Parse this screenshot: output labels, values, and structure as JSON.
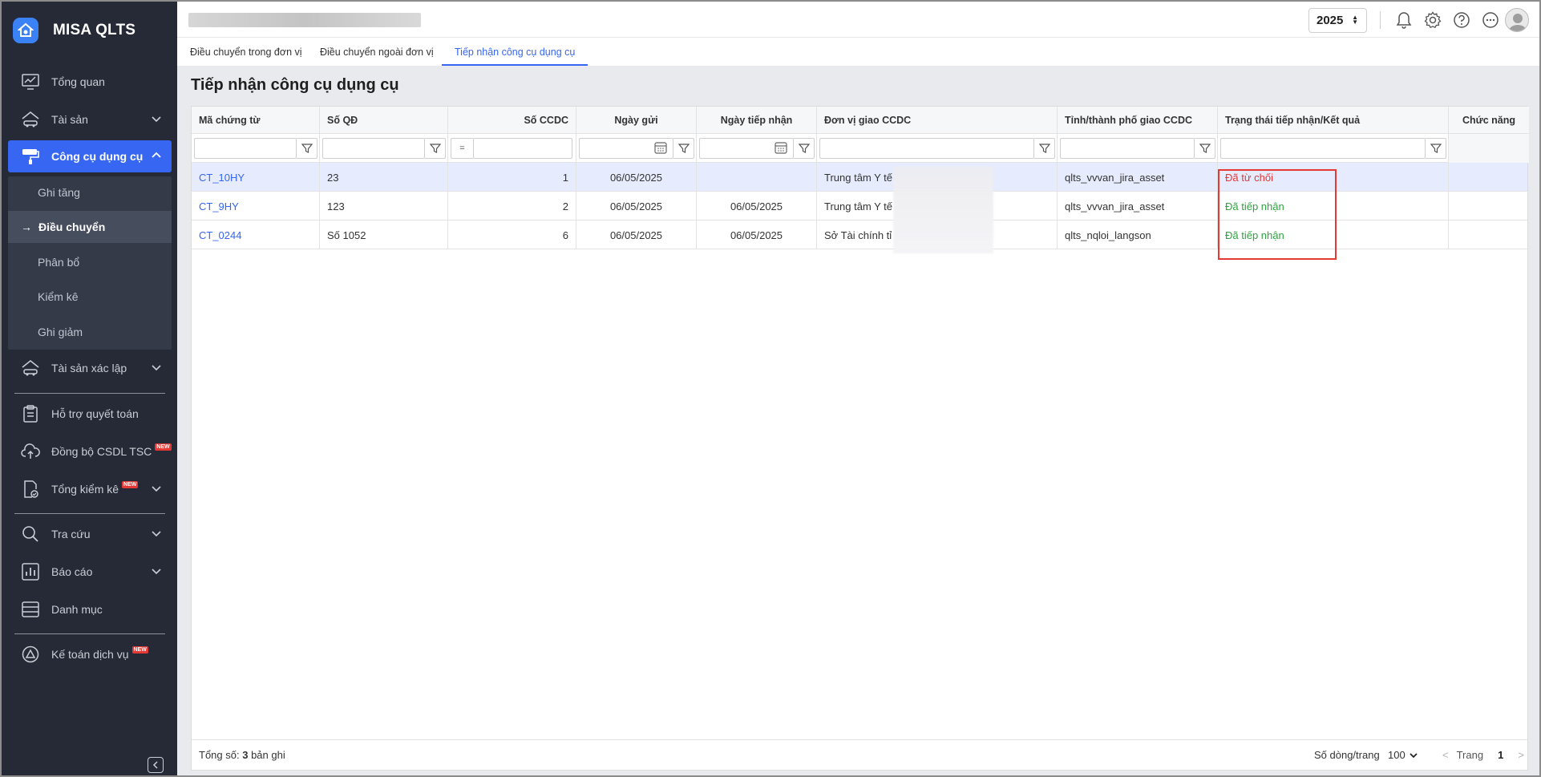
{
  "app": {
    "name": "MISA QLTS"
  },
  "sidebar": {
    "items": [
      {
        "label": "Tổng quan",
        "icon": "chart-monitor-icon"
      },
      {
        "label": "Tài sản",
        "icon": "house-car-icon"
      },
      {
        "label": "Công cụ dụng cụ",
        "icon": "paint-roller-icon"
      },
      {
        "label": "Tài sản xác lập",
        "icon": "house-car-icon"
      },
      {
        "label": "Hỗ trợ quyết toán",
        "icon": "clipboard-icon"
      },
      {
        "label": "Đồng bộ CSDL TSC",
        "icon": "cloud-upload-icon",
        "badge": "NEW"
      },
      {
        "label": "Tổng kiểm kê",
        "icon": "document-check-icon",
        "badge": "NEW"
      },
      {
        "label": "Tra cứu",
        "icon": "search-icon"
      },
      {
        "label": "Báo cáo",
        "icon": "bar-chart-icon"
      },
      {
        "label": "Danh mục",
        "icon": "list-icon"
      },
      {
        "label": "Kế toán dịch vụ",
        "icon": "triangle-logo-icon",
        "badge": "NEW"
      }
    ],
    "sub_items": [
      "Ghi tăng",
      "Điều chuyển",
      "Phân bổ",
      "Kiểm kê",
      "Ghi giảm"
    ],
    "sub_current_arrow": "→"
  },
  "header": {
    "year": "2025"
  },
  "tabs": [
    "Điều chuyển trong đơn vị",
    "Điều chuyển ngoài đơn vị",
    "Tiếp nhận công cụ dụng cụ"
  ],
  "page": {
    "title": "Tiếp nhận công cụ dụng cụ"
  },
  "table": {
    "headers": [
      "Mã chứng từ",
      "Số QĐ",
      "Số CCDC",
      "Ngày gửi",
      "Ngày tiếp nhận",
      "Đơn vị giao CCDC",
      "Tỉnh/thành phố giao CCDC",
      "Trạng thái tiếp nhận/Kết quả",
      "Chức năng"
    ],
    "filter_operator": "=",
    "rows": [
      {
        "ma": "CT_10HY",
        "so_qd": "23",
        "so_ccdc": "1",
        "ngay_gui": "06/05/2025",
        "ngay_tiep_nhan": "",
        "don_vi": "Trung tâm Y tế",
        "tinh": "qlts_vvvan_jira_asset",
        "trang_thai": "Đã từ chối",
        "status_color": "#e53935"
      },
      {
        "ma": "CT_9HY",
        "so_qd": "123",
        "so_ccdc": "2",
        "ngay_gui": "06/05/2025",
        "ngay_tiep_nhan": "06/05/2025",
        "don_vi": "Trung tâm Y tế",
        "tinh": "qlts_vvvan_jira_asset",
        "trang_thai": "Đã tiếp nhận",
        "status_color": "#2fa33f"
      },
      {
        "ma": "CT_0244",
        "so_qd": "Số 1052",
        "so_ccdc": "6",
        "ngay_gui": "06/05/2025",
        "ngay_tiep_nhan": "06/05/2025",
        "don_vi": "Sở Tài chính tỉ",
        "tinh": "qlts_nqloi_langson",
        "trang_thai": "Đã tiếp nhận",
        "status_color": "#2fa33f"
      }
    ]
  },
  "footer": {
    "total_label": "Tổng số:",
    "total_count": "3",
    "total_suffix": "bản ghi",
    "page_size_label": "Số dòng/trang",
    "page_size": "100",
    "page_label": "Trang",
    "page_number": "1"
  },
  "colors": {
    "accent": "#3766f2",
    "sidebar_bg": "#252a36",
    "rejected": "#e53935",
    "accepted": "#2fa33f"
  }
}
